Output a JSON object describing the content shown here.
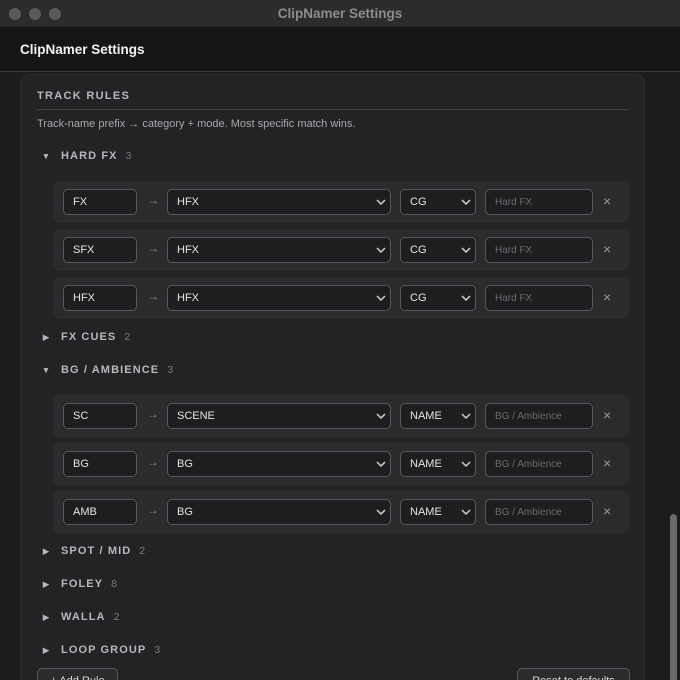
{
  "window": {
    "title": "ClipNamer Settings"
  },
  "header": {
    "title": "ClipNamer Settings"
  },
  "section": {
    "title": "TRACK RULES",
    "description": "Track-name prefix → category + mode. Most specific match wins."
  },
  "icons": {
    "expanded": "▼",
    "collapsed": "▶",
    "arrow": "→",
    "remove": "×",
    "dropdown": "chevron-down-icon"
  },
  "groups": [
    {
      "name": "HARD FX",
      "count": "3",
      "expanded": true,
      "rules": [
        {
          "prefix": "FX",
          "category": "HFX",
          "mode": "CG",
          "label_placeholder": "Hard FX"
        },
        {
          "prefix": "SFX",
          "category": "HFX",
          "mode": "CG",
          "label_placeholder": "Hard FX"
        },
        {
          "prefix": "HFX",
          "category": "HFX",
          "mode": "CG",
          "label_placeholder": "Hard FX"
        }
      ]
    },
    {
      "name": "FX CUES",
      "count": "2",
      "expanded": false
    },
    {
      "name": "BG / AMBIENCE",
      "count": "3",
      "expanded": true,
      "rules": [
        {
          "prefix": "SC",
          "category": "SCENE",
          "mode": "NAME",
          "label_placeholder": "BG / Ambience"
        },
        {
          "prefix": "BG",
          "category": "BG",
          "mode": "NAME",
          "label_placeholder": "BG / Ambience"
        },
        {
          "prefix": "AMB",
          "category": "BG",
          "mode": "NAME",
          "label_placeholder": "BG / Ambience"
        }
      ]
    },
    {
      "name": "SPOT / MID",
      "count": "2",
      "expanded": false
    },
    {
      "name": "FOLEY",
      "count": "8",
      "expanded": false
    },
    {
      "name": "WALLA",
      "count": "2",
      "expanded": false
    },
    {
      "name": "LOOP GROUP",
      "count": "3",
      "expanded": false
    }
  ],
  "buttons": {
    "add_rule": "+ Add Rule",
    "reset": "Reset to defaults"
  }
}
